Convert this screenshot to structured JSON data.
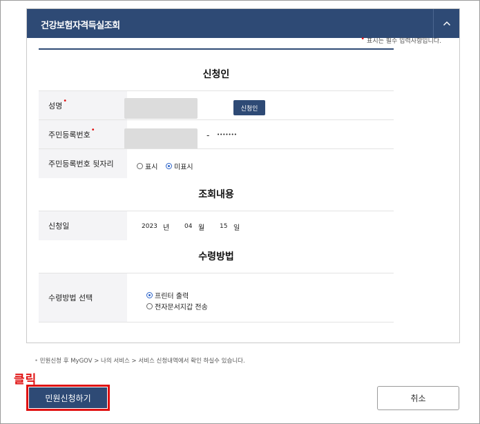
{
  "panel": {
    "title": "건강보험자격득실조회",
    "collapse_icon": "chevron-up-icon",
    "required_mark": "•",
    "required_note": "표시는 필수 입력사항입니다."
  },
  "applicant": {
    "section_title": "신청인",
    "name_label": "성명",
    "name_required": "•",
    "applicant_button": "신청인",
    "rrn_label": "주민등록번호",
    "rrn_required": "•",
    "rrn_separator": "-",
    "rrn_back_mask": "•••••••",
    "rrn_back_label": "주민등록번호 뒷자리",
    "show_option": "표시",
    "hide_option": "미표시",
    "selected_option": "미표시"
  },
  "inquiry": {
    "section_title": "조회내용",
    "date_label": "신청일",
    "year": "2023",
    "year_unit": "년",
    "month": "04",
    "month_unit": "월",
    "day": "15",
    "day_unit": "일"
  },
  "receipt": {
    "section_title": "수령방법",
    "method_label": "수령방법 선택",
    "print_option": "프린터 출력",
    "wallet_option": "전자문서지갑 전송",
    "selected_option": "프린터 출력"
  },
  "footer": {
    "note_bullet": "•",
    "note": "민원신청 후 MyGOV > 나의 서비스 > 서비스 신청내역에서 확인 하실수 있습니다.",
    "annotation": "클릭",
    "apply_button": "민원신청하기",
    "cancel_button": "취소"
  },
  "colors": {
    "header": "#2e4a75",
    "accent_red": "#e01010",
    "label_bg": "#f4f4f6",
    "radio_blue": "#2a62c9"
  }
}
